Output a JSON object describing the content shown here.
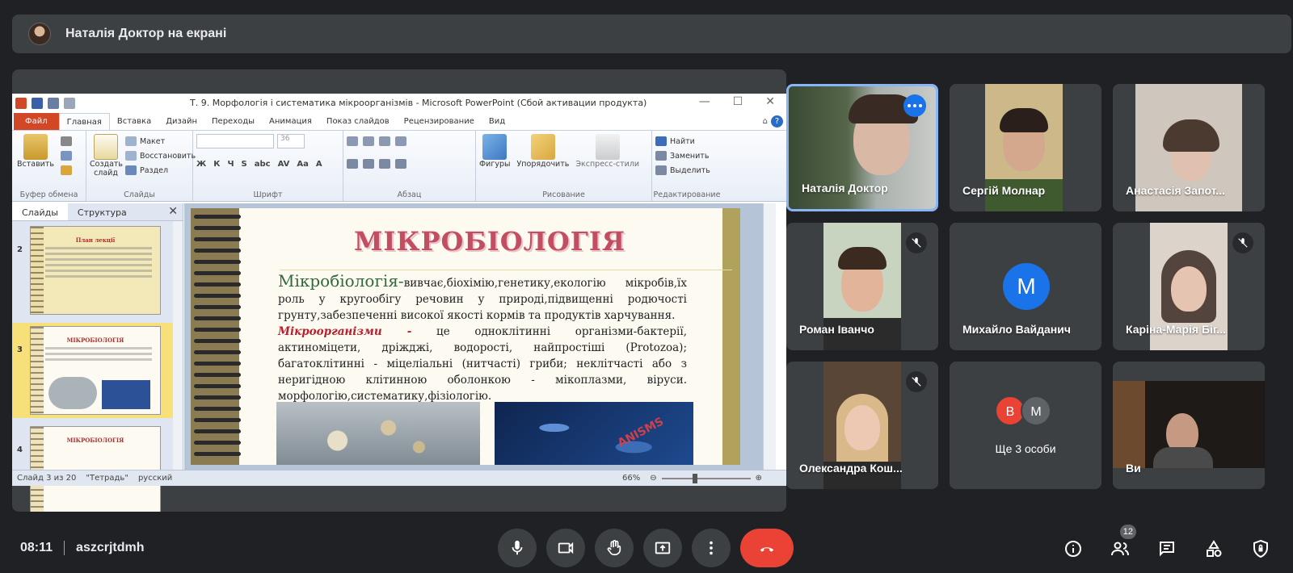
{
  "banner": {
    "text": "Наталія Доктор на екрані"
  },
  "ppt": {
    "window_title": "Т. 9. Морфологія і систематика мікроорганізмів - Microsoft PowerPoint (Сбой активации продукта)",
    "tabs": [
      "Файл",
      "Главная",
      "Вставка",
      "Дизайн",
      "Переходы",
      "Анимация",
      "Показ слайдов",
      "Рецензирование",
      "Вид"
    ],
    "ribbon": {
      "paste": "Вставить",
      "clipboard_group": "Буфер обмена",
      "create_slide": "Создать слайд",
      "layout": "Макет",
      "reset": "Восстановить",
      "section": "Раздел",
      "slides_group": "Слайды",
      "font_size": "36",
      "font_group": "Шрифт",
      "paragraph_group": "Абзац",
      "shapes": "Фигуры",
      "arrange": "Упорядочить",
      "quick_styles": "Экспресс-стили",
      "drawing_group": "Рисование",
      "find": "Найти",
      "replace": "Заменить",
      "select": "Выделить",
      "editing_group": "Редактирование"
    },
    "panel": {
      "tab_slides": "Слайды",
      "tab_outline": "Структура",
      "thumbs": [
        {
          "num": "2",
          "title": "План лекції"
        },
        {
          "num": "3",
          "title": "МІКРОБІОЛОГІЯ"
        },
        {
          "num": "4",
          "title": "МІКРОБІОЛОГІЯ"
        }
      ]
    },
    "slide": {
      "title": "МІКРОБІОЛОГІЯ",
      "p1_lead": "Мікробіологія-",
      "p1_text": "вивчає,біохімію,генетику,екологію      мікробів,їх роль у кругообігу речовин у природі,підвищенні родючості грунту,забезпеченні високої якості кормів та продуктів харчування.",
      "p2_lead": "Мікроорганізми -",
      "p2_text": " це одноклітинні організми-бактерії, актиноміцети, дріжджі, водорості, найпростіші (Protozoa); багатоклітинні - міцеліальні (нитчасті) гриби; неклітчасті або з неригідною клітинною оболонкою - мікоплазми, віруси. морфологію,систематику,фізіологію.",
      "img2_word": "ANISMS"
    },
    "status": {
      "slide": "Слайд 3 из 20",
      "theme": "\"Тетрадь\"",
      "lang": "русский",
      "zoom": "66%"
    }
  },
  "participants": [
    {
      "name": "Наталія Доктор",
      "muted": false
    },
    {
      "name": "Сергій Молнар",
      "muted": false
    },
    {
      "name": "Анастасія Запот...",
      "muted": false
    },
    {
      "name": "Роман Іванчо",
      "muted": true
    },
    {
      "name": "Михайло Вайданич",
      "initial": "M",
      "muted": false
    },
    {
      "name": "Каріна-Марія Біг...",
      "muted": true
    },
    {
      "name": "Олександра Кош...",
      "muted": true
    },
    {
      "name": "Ще 3 особи",
      "initials": [
        "B",
        "M"
      ]
    },
    {
      "name": "Ви",
      "muted": false
    }
  ],
  "meeting": {
    "time": "08:11",
    "code": "aszcrjtdmh",
    "participant_count": "12"
  },
  "colors": {
    "bg": "#202124",
    "tile": "#3c4043",
    "hangup": "#ea4335",
    "accent": "#1a73e8"
  }
}
